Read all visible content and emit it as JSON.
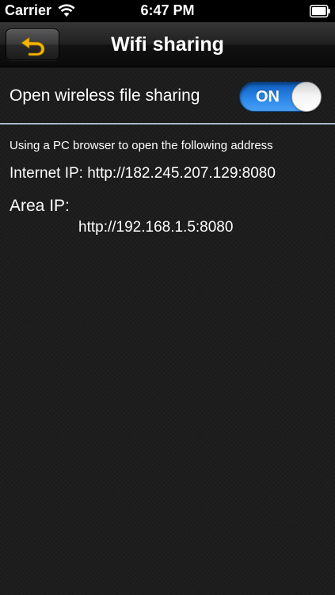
{
  "status_bar": {
    "carrier": "Carrier",
    "time": "6:47 PM",
    "signal_icon": "wifi-icon",
    "battery_icon": "battery-icon"
  },
  "nav_bar": {
    "title": "Wifi sharing",
    "back_icon": "back-arrow-icon",
    "back_icon_color": "#f5b700"
  },
  "sharing": {
    "label": "Open wireless file sharing",
    "switch_text": "ON",
    "enabled": true,
    "switch_color": "#2a86ea"
  },
  "info": {
    "instruction": "Using a PC browser to open the following address",
    "internet_ip": "Internet IP: http://182.245.207.129:8080",
    "area_ip_label": "Area IP:",
    "area_ip_address": "http://192.168.1.5:8080"
  }
}
